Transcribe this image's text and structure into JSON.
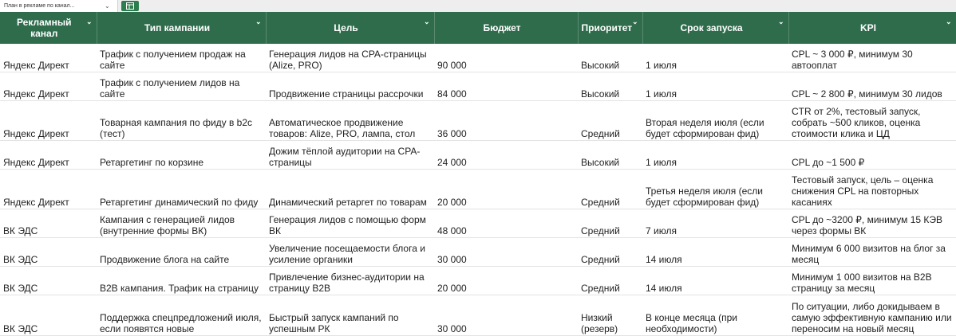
{
  "sheet_tab": {
    "label": "План в рекламе по канал..."
  },
  "columns": [
    "Рекламный канал",
    "Тип кампании",
    "Цель",
    "Бюджет",
    "Приоритет",
    "Срок запуска",
    "KPI"
  ],
  "rows": [
    [
      "Яндекс Директ",
      "Трафик с получением продаж на сайте",
      "Генерация лидов на CPA-страницы (Alize, PRO)",
      "90 000",
      "Высокий",
      "1 июля",
      "CPL ~ 3 000 ₽, минимум 30 автооплат"
    ],
    [
      "Яндекс Директ",
      "Трафик с получением лидов на сайте",
      "Продвижение страницы рассрочки",
      "84 000",
      "Высокий",
      "1 июля",
      "CPL ~ 2 800 ₽, минимум 30 лидов"
    ],
    [
      "Яндекс Директ",
      "Товарная кампания по фиду в b2c (тест)",
      "Автоматическое продвижение товаров: Alize, PRO, лампа, стол",
      "36 000",
      "Средний",
      "Вторая неделя июля (если будет сформирован фид)",
      "CTR от 2%, тестовый запуск, собрать ~500 кликов, оценка стоимости клика и ЦД"
    ],
    [
      "Яндекс Директ",
      "Ретаргетинг по корзине",
      "Дожим тёплой аудитории на CPA-страницы",
      "24 000",
      "Высокий",
      "1 июля",
      "CPL до ~1 500 ₽"
    ],
    [
      "Яндекс Директ",
      "Ретаргетинг динамический по фиду",
      "Динамический ретаргет по товарам",
      "20 000",
      "Средний",
      "Третья неделя июля (если будет сформирован фид)",
      "Тестовый запуск, цель – оценка снижения CPL на повторных касаниях"
    ],
    [
      "ВК ЭДС",
      "Кампания с генерацией лидов (внутренние формы ВК)",
      "Генерация лидов с помощью форм ВК",
      "48 000",
      "Средний",
      "7 июля",
      "CPL до ~3200 ₽, минимум 15 КЭВ через формы ВК"
    ],
    [
      "ВК ЭДС",
      "Продвижение блога на сайте",
      "Увеличение посещаемости блога и усиление органики",
      "30 000",
      "Средний",
      "14 июля",
      "Минимум 6 000 визитов на блог за месяц"
    ],
    [
      "ВК ЭДС",
      "B2B кампания. Трафик на страницу",
      "Привлечение бизнес-аудитории на страницу B2B",
      "20 000",
      "Средний",
      "14 июля",
      "Минимум 1 000 визитов на B2B страницу за месяц"
    ],
    [
      "ВК ЭДС",
      "Поддержка спецпредложений июля, если появятся новые",
      "Быстрый запуск кампаний по успешным РК",
      "30 000",
      "Низкий (резерв)",
      "В конце месяца (при необходимости)",
      "По ситуации, либо докидываем в самую эффективную кампанию или переносим на новый месяц"
    ]
  ]
}
